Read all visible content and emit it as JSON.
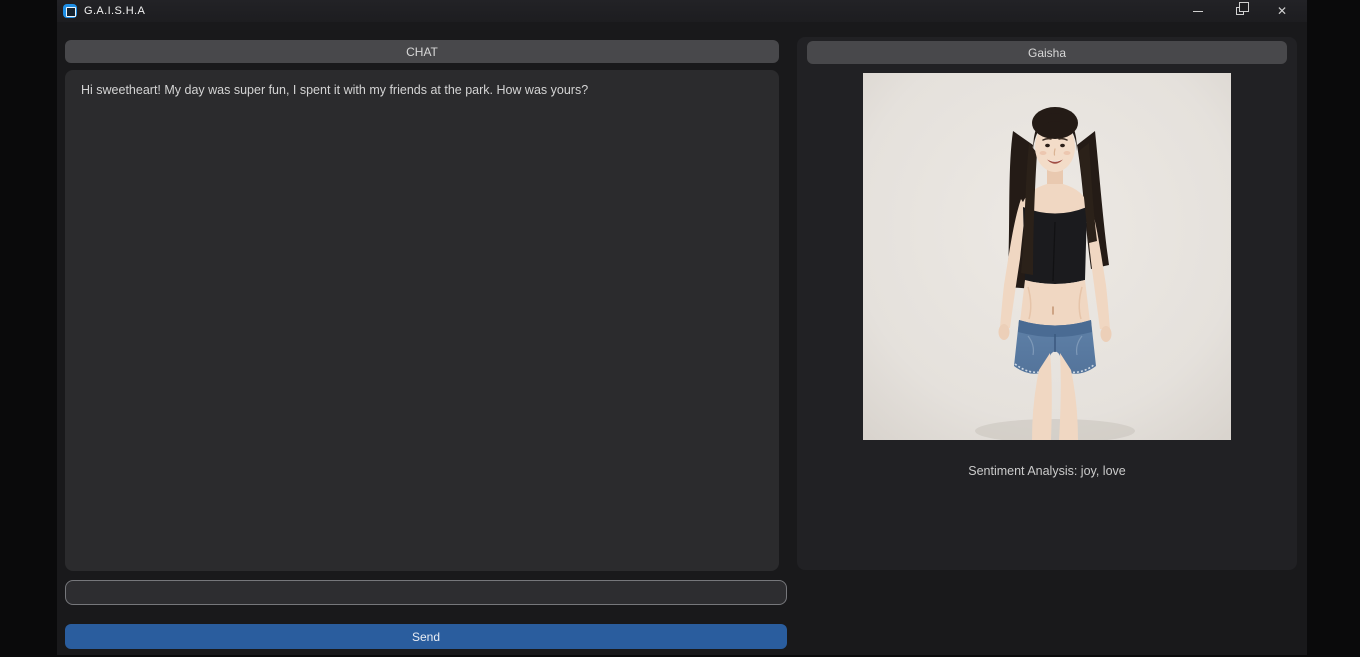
{
  "window": {
    "title": "G.A.I.S.H.A",
    "controls": {
      "minimize_icon": "–",
      "restore_icon": "❐",
      "close_icon": "✕"
    }
  },
  "icons": {
    "app_icon": "blue rounded square with inner square outline"
  },
  "chat_panel": {
    "header_label": "CHAT",
    "messages": [
      {
        "text": "Hi sweetheart! My day was super fun, I spent it with my friends at the park. How was yours?"
      }
    ],
    "input": {
      "value": "",
      "placeholder": ""
    },
    "send_label": "Send"
  },
  "companion_panel": {
    "header_label": "Gaisha",
    "image_alt": "Full-length photo of a smiling young woman with long dark hair wearing a black strapless crop top and denim shorts against a beige studio background",
    "sentiment_text": "Sentiment Analysis: joy, love"
  },
  "colors": {
    "accent_blue": "#2a5d9e",
    "app_icon_blue": "#1e8fe6",
    "desktop_black": "#0a0a0b",
    "window_bg": "#19191b",
    "titlebar_bg": "#212125",
    "panel_bg": "#2b2b2d",
    "companion_panel_bg": "#212124",
    "header_pill_bg": "#48484b",
    "text_light": "#d4d4d4"
  }
}
